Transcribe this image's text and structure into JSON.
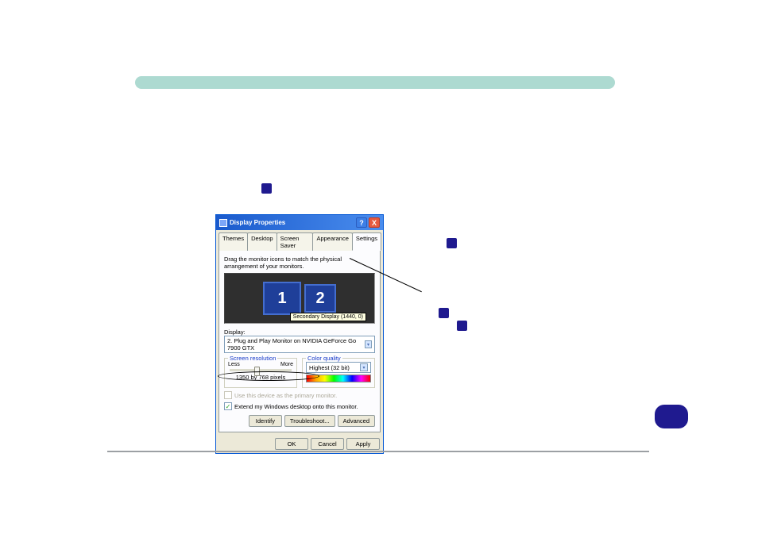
{
  "dialog": {
    "title": "Display Properties",
    "help": "?",
    "close": "X",
    "tabs": [
      "Themes",
      "Desktop",
      "Screen Saver",
      "Appearance",
      "Settings"
    ],
    "activeTab": 4,
    "instruction": "Drag the monitor icons to match the physical arrangement of your monitors.",
    "monitor1": "1",
    "monitor2": "2",
    "tooltip": "Secondary Display (1440, 0)",
    "display_label": "Display:",
    "display_value": "2. Plug and Play Monitor on NVIDIA GeForce Go 7900 GTX",
    "res_title": "Screen resolution",
    "res_less": "Less",
    "res_more": "More",
    "res_value": "1350 by 768 pixels",
    "color_title": "Color quality",
    "color_value": "Highest (32 bit)",
    "chk1": "Use this device as the primary monitor.",
    "chk2": "Extend my Windows desktop onto this monitor.",
    "btn_identify": "Identify",
    "btn_troubleshoot": "Troubleshoot...",
    "btn_advanced": "Advanced",
    "btn_ok": "OK",
    "btn_cancel": "Cancel",
    "btn_apply": "Apply"
  }
}
